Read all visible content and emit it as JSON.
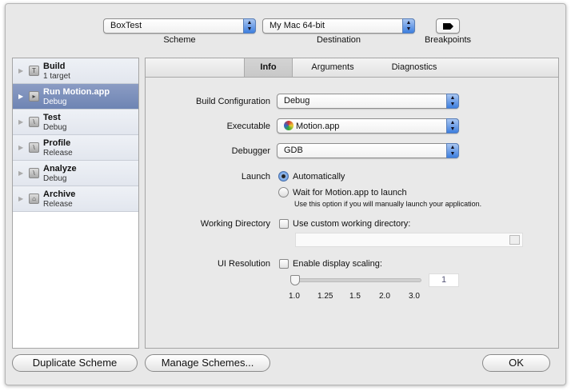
{
  "toolbar": {
    "scheme_value": "BoxTest",
    "scheme_label": "Scheme",
    "destination_value": "My Mac 64-bit",
    "destination_label": "Destination",
    "breakpoints_label": "Breakpoints"
  },
  "sidebar": {
    "items": [
      {
        "title": "Build",
        "subtitle": "1 target",
        "icon": "hammer-icon"
      },
      {
        "title": "Run Motion.app",
        "subtitle": "Debug",
        "icon": "play-icon"
      },
      {
        "title": "Test",
        "subtitle": "Debug",
        "icon": "wrench-icon"
      },
      {
        "title": "Profile",
        "subtitle": "Release",
        "icon": "wrench-icon"
      },
      {
        "title": "Analyze",
        "subtitle": "Debug",
        "icon": "wrench-icon"
      },
      {
        "title": "Archive",
        "subtitle": "Release",
        "icon": "archive-icon"
      }
    ]
  },
  "tabs": [
    "Info",
    "Arguments",
    "Diagnostics"
  ],
  "form": {
    "build_config_label": "Build Configuration",
    "build_config_value": "Debug",
    "executable_label": "Executable",
    "executable_value": "Motion.app",
    "debugger_label": "Debugger",
    "debugger_value": "GDB",
    "launch_label": "Launch",
    "launch_auto": "Automatically",
    "launch_wait": "Wait for Motion.app to launch",
    "launch_note": "Use this option if you will manually launch your application.",
    "workdir_label": "Working Directory",
    "workdir_checkbox": "Use custom working directory:",
    "workdir_value": "",
    "uires_label": "UI Resolution",
    "uires_checkbox": "Enable display scaling:",
    "scale_value": "1",
    "scale_ticks": [
      "1.0",
      "1.25",
      "1.5",
      "2.0",
      "3.0"
    ]
  },
  "buttons": {
    "duplicate": "Duplicate Scheme",
    "manage": "Manage Schemes...",
    "ok": "OK"
  }
}
